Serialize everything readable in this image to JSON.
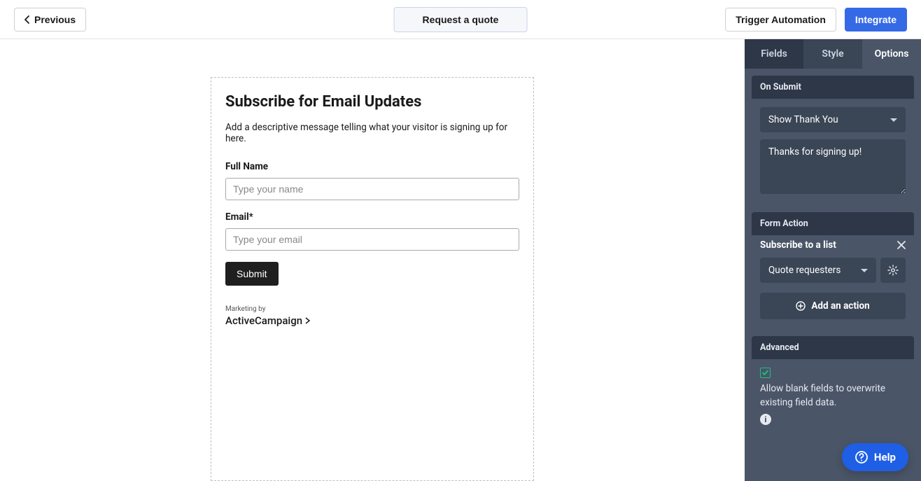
{
  "topbar": {
    "previous": "Previous",
    "center_title": "Request a quote",
    "trigger": "Trigger Automation",
    "integrate": "Integrate"
  },
  "form": {
    "title": "Subscribe for Email Updates",
    "description": "Add a descriptive message telling what your visitor is signing up for here.",
    "fullname_label": "Full Name",
    "fullname_placeholder": "Type your name",
    "email_label": "Email*",
    "email_placeholder": "Type your email",
    "submit": "Submit",
    "marketing_by": "Marketing by",
    "brand": "ActiveCampaign"
  },
  "panel": {
    "tabs": {
      "fields": "Fields",
      "style": "Style",
      "options": "Options"
    },
    "on_submit": {
      "header": "On Submit",
      "mode": "Show Thank You",
      "message": "Thanks for signing up!"
    },
    "form_action": {
      "header": "Form Action",
      "action_label": "Subscribe to a list",
      "list_selected": "Quote requesters",
      "add_action": "Add an action"
    },
    "advanced": {
      "header": "Advanced",
      "checkbox_checked": true,
      "text": "Allow blank fields to overwrite existing field data."
    }
  },
  "help": {
    "label": "Help"
  }
}
